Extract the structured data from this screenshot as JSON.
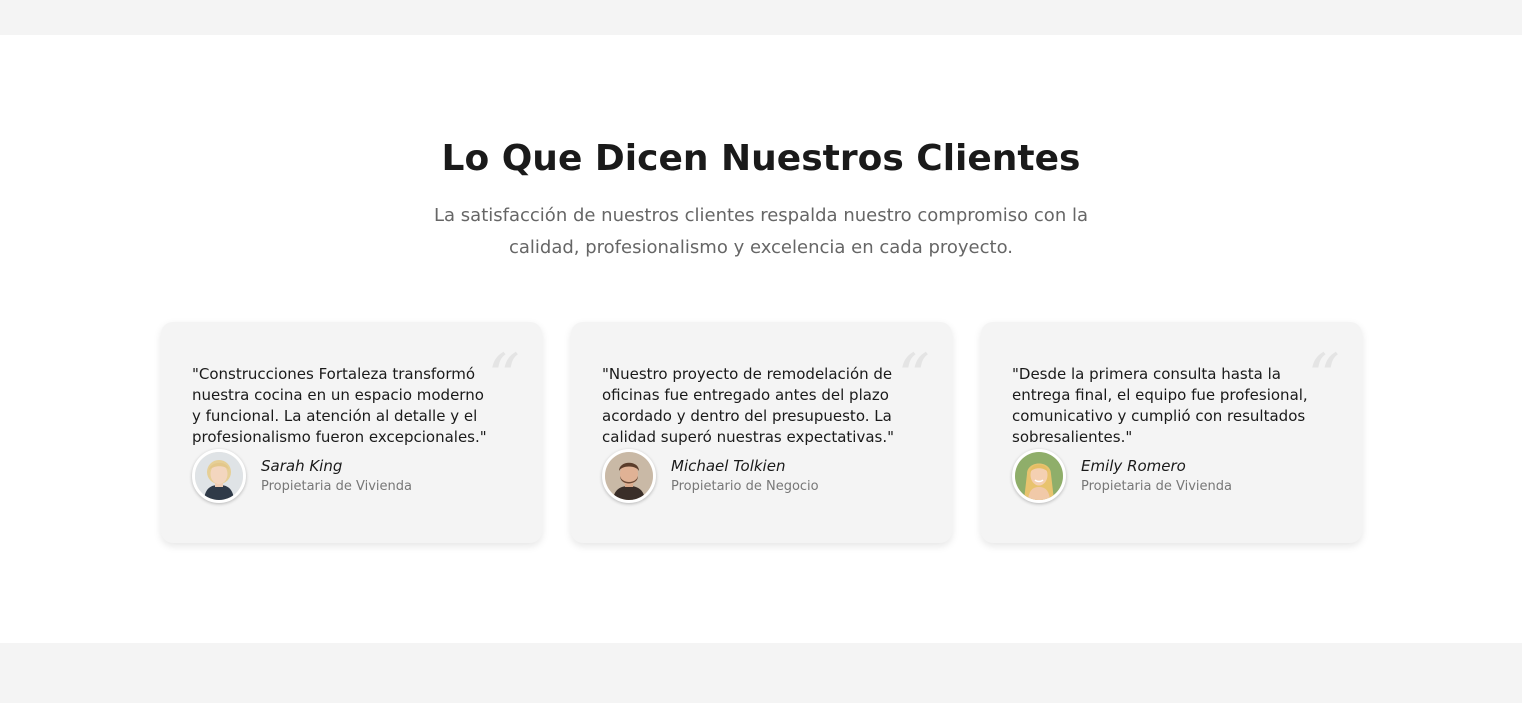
{
  "section": {
    "title": "Lo Que Dicen Nuestros Clientes",
    "subtitle": "La satisfacción de nuestros clientes respalda nuestro compromiso con la calidad, profesionalismo y excelencia en cada proyecto."
  },
  "colors": {
    "page_background": "#ffffff",
    "band_background": "#f4f4f4",
    "card_background": "#f4f4f4",
    "title_color": "#1a1a1a",
    "muted_text": "#666666"
  },
  "testimonials": [
    {
      "quote": "\"Construcciones Fortaleza transformó nuestra cocina en un espacio moderno y funcional. La atención al detalle y el profesionalismo fueron excepcionales.\"",
      "name": "Sarah King",
      "role": "Propietaria de Vivienda",
      "quote_icon": "quote-icon",
      "avatar_icon": "avatar-woman-blonde-short"
    },
    {
      "quote": "\"Nuestro proyecto de remodelación de oficinas fue entregado antes del plazo acordado y dentro del presupuesto. La calidad superó nuestras expectativas.\"",
      "name": "Michael Tolkien",
      "role": "Propietario de Negocio",
      "quote_icon": "quote-icon",
      "avatar_icon": "avatar-man-beard"
    },
    {
      "quote": "\"Desde la primera consulta hasta la entrega final, el equipo fue profesional, comunicativo y cumplió con resultados sobresalientes.\"",
      "name": "Emily Romero",
      "role": "Propietaria de Vivienda",
      "quote_icon": "quote-icon",
      "avatar_icon": "avatar-woman-blonde-long"
    }
  ]
}
